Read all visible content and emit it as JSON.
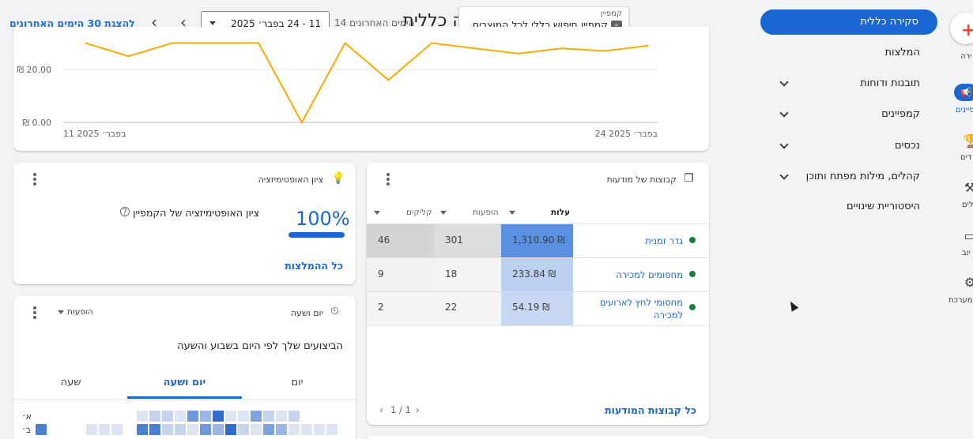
{
  "header": {
    "page_title": "סקירה כללית",
    "campaign_label": "קמפיין",
    "campaign_value": "קמפיין חיפוש כללי לכל המוצרים",
    "range_label": "14 הימים האחרונים",
    "date_range": "11 - 24 בפבר׳ 2025",
    "show_30_days": "להצגת 30 הימים האחרונים"
  },
  "side_nav": {
    "items": [
      {
        "label": "סקירה כללית",
        "active": true
      },
      {
        "label": "המלצות"
      },
      {
        "label": "תובנות ודוחות",
        "expandable": true
      },
      {
        "label": "קמפיינים",
        "expandable": true
      },
      {
        "label": "נכסים",
        "expandable": true
      },
      {
        "label": "קהלים, מילות מפתח ותוכן",
        "expandable": true
      },
      {
        "label": "היסטוריית שינויים"
      }
    ]
  },
  "rail": {
    "items": [
      {
        "label": "ירה",
        "icon": "google-plus-icon"
      },
      {
        "label": "פיינים",
        "icon": "megaphone-icon"
      },
      {
        "label": "דים",
        "icon": "trophy-icon"
      },
      {
        "label": "לים",
        "icon": "tools-icon"
      },
      {
        "label": "יוב",
        "icon": "credit-card-icon"
      },
      {
        "label": "מערכת",
        "icon": "gear-icon"
      }
    ]
  },
  "chart_data": {
    "type": "line",
    "title": "",
    "xlabel": "",
    "ylabel": "",
    "ylim": [
      0,
      30
    ],
    "y_ticks": [
      "₪ 0.00",
      "₪ 20.00"
    ],
    "x_tick_labels": [
      "11 בפבר׳ 2025",
      "24 בפבר׳ 2025"
    ],
    "x": [
      "11",
      "12",
      "13",
      "14",
      "15",
      "16",
      "17",
      "18",
      "19",
      "20",
      "21",
      "22",
      "23",
      "24"
    ],
    "series": [
      {
        "color": "#f9ab00",
        "values": [
          30,
          25,
          30,
          30,
          30,
          0,
          30,
          16,
          30,
          28,
          26,
          28,
          27,
          29
        ]
      }
    ]
  },
  "ad_groups_card": {
    "title": "קבוצות של מודעות",
    "columns": [
      "עלות",
      "הופעות",
      "קליקים"
    ],
    "rows": [
      {
        "name": "גדר זמנית",
        "cost": "1,310.90 ₪",
        "impressions": "301",
        "clicks": "46"
      },
      {
        "name": "מחסומים למכירה",
        "cost": "233.84 ₪",
        "impressions": "18",
        "clicks": "9"
      },
      {
        "name": "מחסומי לחץ לארועים למכירה",
        "cost": "54.19 ₪",
        "impressions": "22",
        "clicks": "2"
      }
    ],
    "footer_link": "כל קבוצות המודעות",
    "pagination": "1 / 1"
  },
  "optimization_card": {
    "title": "ציון האופטימיזציה",
    "score": "100%",
    "score_fraction": 1.0,
    "score_label": "ציון האופטימיזציה של הקמפיין",
    "footer_link": "כל ההמלצות"
  },
  "day_hour_card": {
    "title": "יום ושעה",
    "metric_select": "הופעות",
    "subtitle": "הביצועים שלך לפי היום בשבוע והשעה",
    "tabs": [
      "יום",
      "יום ושעה",
      "שעה"
    ],
    "active_tab": "יום ושעה",
    "row_labels": [
      "א׳",
      "ב׳"
    ]
  },
  "colors": {
    "primary": "#1967d2",
    "chart_line": "#f9ab00",
    "heat_strong": "#4a7fd4",
    "heat_light": "#c6d4ee"
  }
}
